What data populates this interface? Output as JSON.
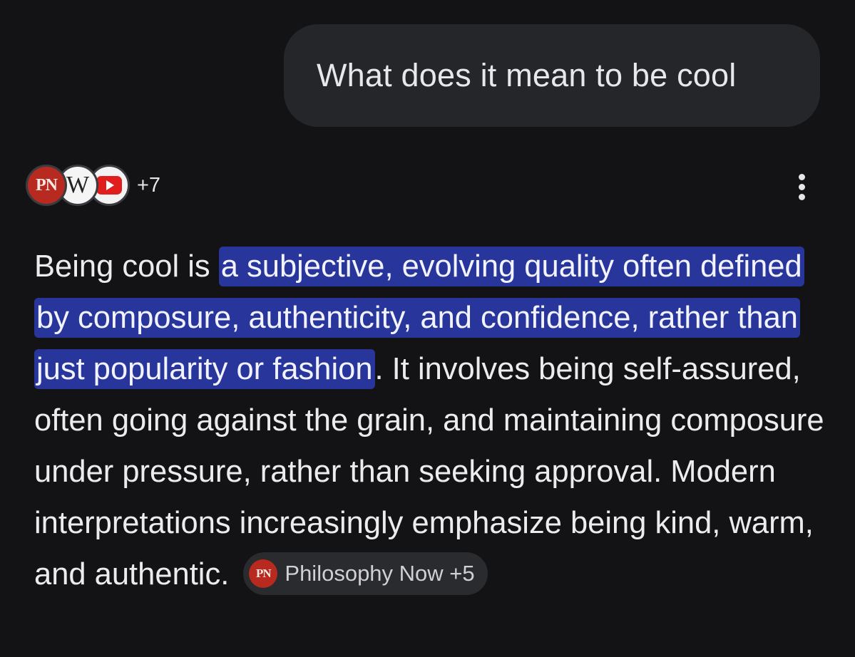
{
  "user_message": {
    "text": "What does it mean to be cool"
  },
  "sources": {
    "icons": [
      {
        "name": "philosophy-now-icon",
        "text": "PN"
      },
      {
        "name": "wikipedia-icon",
        "text": "W"
      },
      {
        "name": "youtube-icon",
        "text": ""
      }
    ],
    "more_count": "+7"
  },
  "menu": {
    "icon": "more-vert-icon"
  },
  "answer": {
    "lead": "Being cool is ",
    "highlight": "a subjective, evolving quality often defined by composure, authenticity, and confidence, rather than just popularity or fashion",
    "rest": ". It involves being self-assured, often going against the grain, and maintaining composure under pressure, rather than seeking approval. Modern interpretations increasingly emphasize being kind, warm, and authentic. "
  },
  "citation": {
    "icon_text": "PN",
    "label": "Philosophy Now +5"
  },
  "colors": {
    "background": "#131315",
    "bubble": "#25262a",
    "highlight": "#28369c",
    "chip": "#2a2b2f",
    "pn_red": "#b8291f",
    "youtube_red": "#e01e1e"
  }
}
